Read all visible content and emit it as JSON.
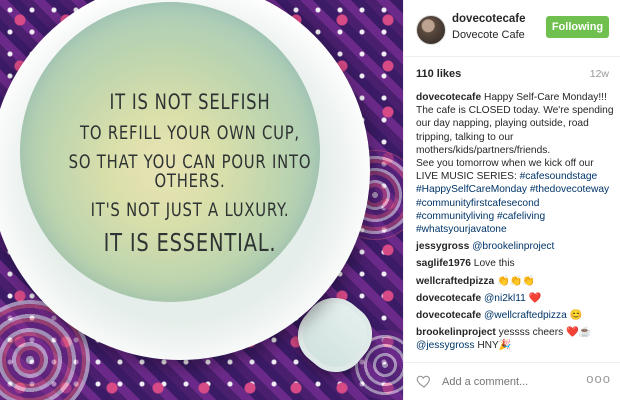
{
  "photo": {
    "quote_lines": [
      "It is not selfish",
      "to refill your own cup,",
      "so that you can pour into others.",
      "It's not just a luxury.",
      "It is essential."
    ]
  },
  "header": {
    "username": "dovecotecafe",
    "location": "Dovecote Cafe",
    "follow_label": "Following"
  },
  "meta": {
    "likes": "110 likes",
    "age": "12w"
  },
  "caption": {
    "user": "dovecotecafe",
    "lines": [
      "Happy Self-Care Monday!!!",
      "The cafe is CLOSED today. We're spending",
      "our day napping, playing outside, road",
      "tripping, talking to our",
      "mothers/kids/partners/friends.",
      "See you tomorrow when we kick off our",
      "LIVE MUSIC SERIES:"
    ],
    "tags": [
      "#cafesoundstage",
      "#HappySelfCareMonday",
      "#thedovecoteway",
      "#communityfirstcafesecond",
      "#communityliving",
      "#cafeliving",
      "#whatsyourjavatone"
    ]
  },
  "comments": [
    {
      "user": "jessygross",
      "mention": "@brookelinproject",
      "text": ""
    },
    {
      "user": "saglife1976",
      "mention": "",
      "text": "Love this"
    },
    {
      "user": "wellcraftedpizza",
      "mention": "",
      "text": "👏👏👏"
    },
    {
      "user": "dovecotecafe",
      "mention": "@ni2kl11",
      "text": "❤️"
    },
    {
      "user": "dovecotecafe",
      "mention": "@wellcraftedpizza",
      "text": "😊"
    },
    {
      "user": "brookelinproject",
      "mention": "",
      "text": "yessss cheers ❤️☕",
      "mention2": "@jessygross",
      "text2": "HNY🎉"
    }
  ],
  "add_comment": {
    "placeholder": "Add a comment..."
  },
  "more_label": "ooo",
  "icons": {
    "like": "heart-outline-icon"
  },
  "colors": {
    "follow_bg": "#70c050",
    "link": "#003569",
    "muted": "#999999"
  }
}
